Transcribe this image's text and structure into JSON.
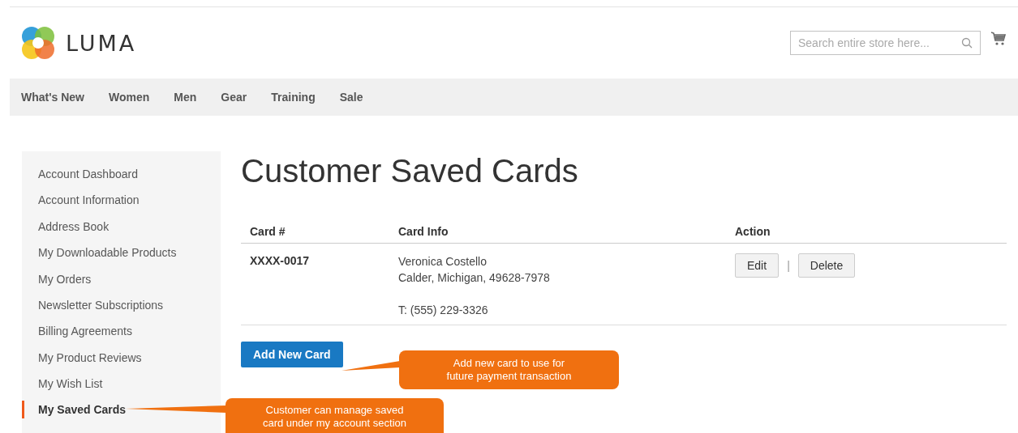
{
  "header": {
    "logo_text": "LUMA",
    "search": {
      "placeholder": "Search entire store here..."
    }
  },
  "nav": [
    {
      "label": "What's New"
    },
    {
      "label": "Women"
    },
    {
      "label": "Men"
    },
    {
      "label": "Gear"
    },
    {
      "label": "Training"
    },
    {
      "label": "Sale"
    }
  ],
  "sidebar": {
    "items": [
      {
        "label": "Account Dashboard",
        "selected": false
      },
      {
        "label": "Account Information",
        "selected": false
      },
      {
        "label": "Address Book",
        "selected": false
      },
      {
        "label": "My Downloadable Products",
        "selected": false
      },
      {
        "label": "My Orders",
        "selected": false
      },
      {
        "label": "Newsletter Subscriptions",
        "selected": false
      },
      {
        "label": "Billing Agreements",
        "selected": false
      },
      {
        "label": "My Product Reviews",
        "selected": false
      },
      {
        "label": "My Wish List",
        "selected": false
      },
      {
        "label": "My Saved Cards",
        "selected": true
      }
    ]
  },
  "page_title": "Customer Saved Cards",
  "table": {
    "columns": [
      "Card #",
      "Card Info",
      "Action"
    ],
    "rows": [
      {
        "card": "XXXX-0017",
        "info": [
          "Veronica Costello",
          "Calder, Michigan, 49628-7978"
        ],
        "phone": "T: (555) 229-3326",
        "actions": [
          "Edit",
          "Delete"
        ],
        "separator": "|"
      }
    ]
  },
  "add_button": "Add New Card",
  "callouts": [
    {
      "kind": "button",
      "text": "Add new card to use for\nfuture payment transaction"
    },
    {
      "kind": "sidebar",
      "text": "Customer can manage saved\ncard under my account section"
    }
  ]
}
